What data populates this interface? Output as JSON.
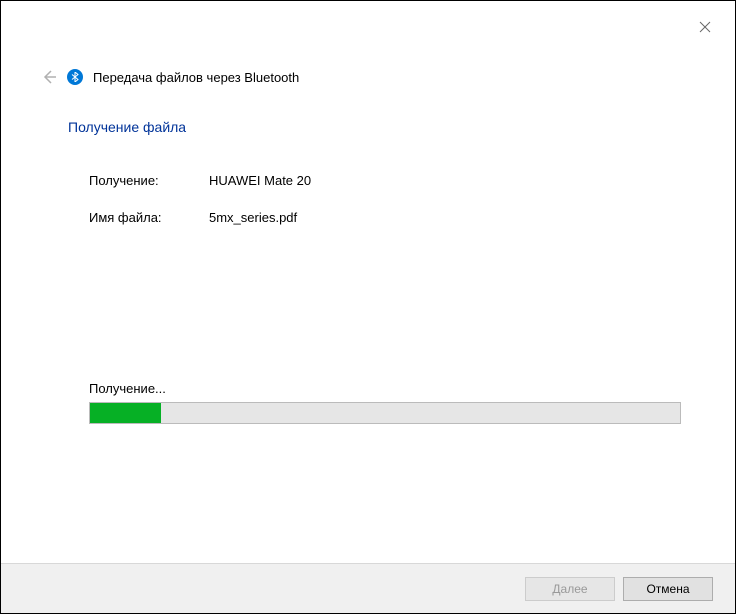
{
  "header": {
    "title": "Передача файлов через Bluetooth"
  },
  "section": {
    "title": "Получение файла"
  },
  "info": {
    "receiving_label": "Получение:",
    "receiving_value": "HUAWEI Mate 20",
    "filename_label": "Имя файла:",
    "filename_value": "5mx_series.pdf"
  },
  "progress": {
    "label": "Получение...",
    "percent": 12
  },
  "buttons": {
    "next": "Далее",
    "cancel": "Отмена"
  }
}
